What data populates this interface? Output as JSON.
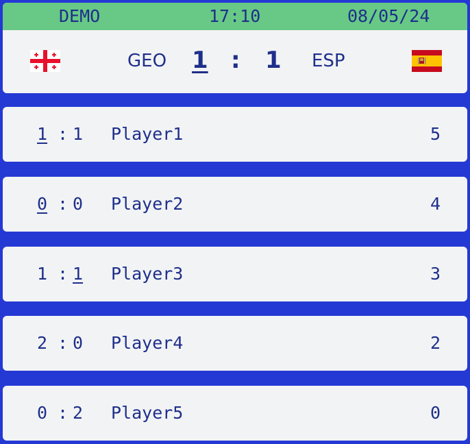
{
  "header": {
    "mode": "DEMO",
    "time": "17:10",
    "date": "08/05/24"
  },
  "match": {
    "home": {
      "code": "GEO",
      "flag": "georgia-flag-icon",
      "goals": "1"
    },
    "separator": ":",
    "away": {
      "code": "ESP",
      "flag": "spain-flag-icon",
      "goals": "1"
    }
  },
  "predictions": [
    {
      "home": "1",
      "sep": ":",
      "away": "1",
      "player": "Player1",
      "points": "5"
    },
    {
      "home": "0",
      "sep": ":",
      "away": "0",
      "player": "Player2",
      "points": "4"
    },
    {
      "home": "1",
      "sep": ":",
      "away": "1",
      "player": "Player3",
      "points": "3"
    },
    {
      "home": "2",
      "sep": ":",
      "away": "0",
      "player": "Player4",
      "points": "2"
    },
    {
      "home": "0",
      "sep": ":",
      "away": "2",
      "player": "Player5",
      "points": "0"
    }
  ],
  "colors": {
    "background": "#2439d4",
    "topbar": "#67c985",
    "panel": "#f2f3f5",
    "text": "#1e2f8a",
    "georgia_red": "#e8112d",
    "spain_red": "#c60b1e",
    "spain_yellow": "#ffc400"
  }
}
